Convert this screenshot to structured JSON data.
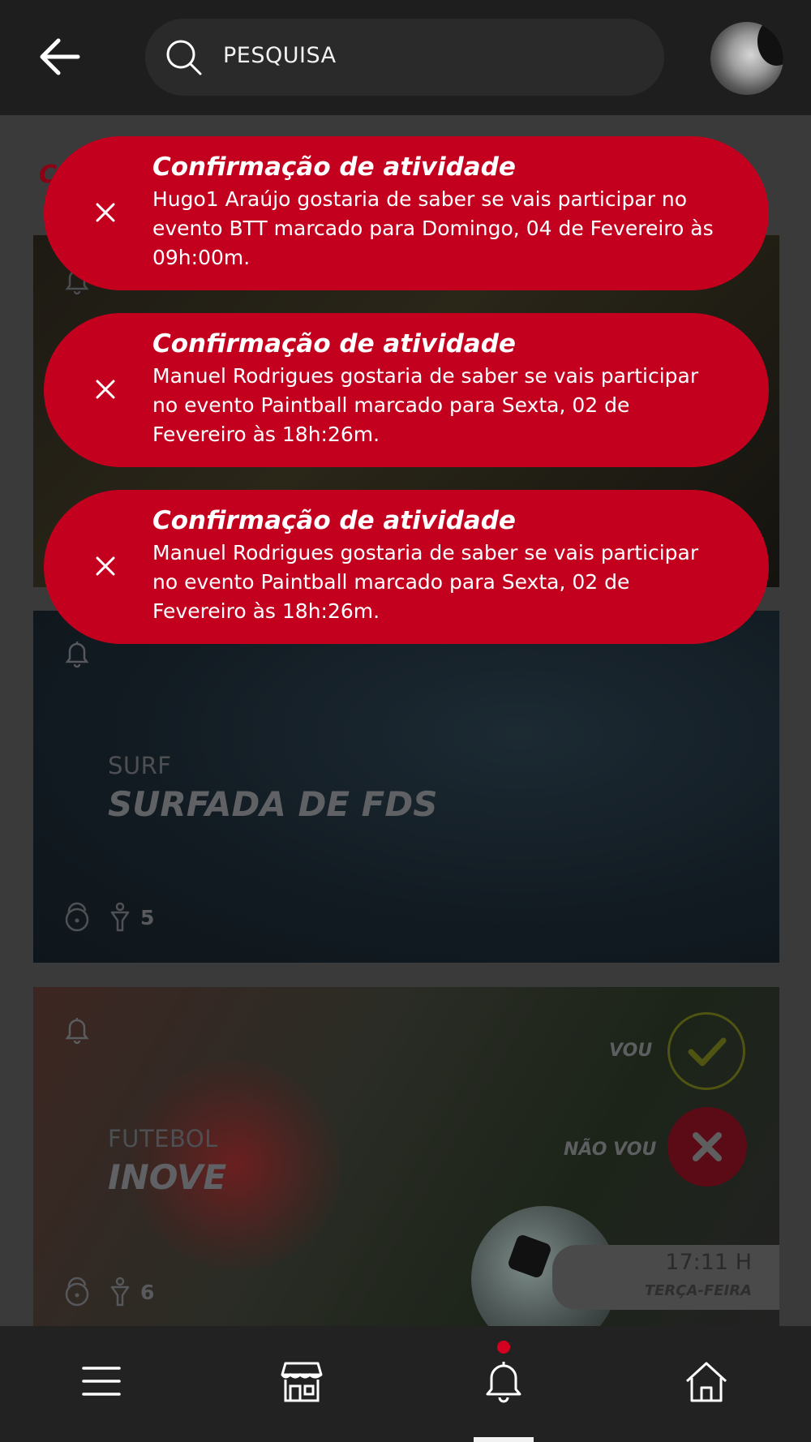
{
  "header": {
    "search_placeholder": "PESQUISA"
  },
  "notifications": [
    {
      "title": "Confirmação de atividade",
      "body": "Hugo1 Araújo gostaria de saber se vais participar no evento BTT marcado para Domingo, 04 de Fevereiro às 09h:00m."
    },
    {
      "title": "Confirmação de atividade",
      "body": "Manuel Rodrigues  gostaria de saber se vais participar no evento Paintball marcado para Sexta, 02 de Fevereiro às 18h:26m."
    },
    {
      "title": "Confirmação de atividade",
      "body": "Manuel Rodrigues  gostaria de saber se vais participar no evento Paintball marcado para Sexta, 02 de Fevereiro às 18h:26m."
    }
  ],
  "page_heading_fragment": "C",
  "activities": [
    {
      "sport": "SURF",
      "title": "SURFADA DE FDS",
      "participants": "5"
    },
    {
      "sport": "FUTEBOL",
      "title": "INOVE",
      "participants": "6",
      "vou_label": "VOU",
      "nao_vou_label": "NÃO VOU",
      "time": "17:11 H",
      "day": "TERÇA-FEIRA"
    }
  ],
  "colors": {
    "notification_bg": "#c4001f",
    "header_bg": "#1e1e1e",
    "nav_bg": "#222222",
    "badge_dot": "#d4001f"
  },
  "icons": {
    "back": "arrow-left-icon",
    "search": "search-icon",
    "close": "close-icon",
    "bell": "bell-icon",
    "lock": "unlock-icon",
    "person": "person-icon",
    "menu": "menu-icon",
    "store": "store-icon",
    "home": "home-icon"
  }
}
